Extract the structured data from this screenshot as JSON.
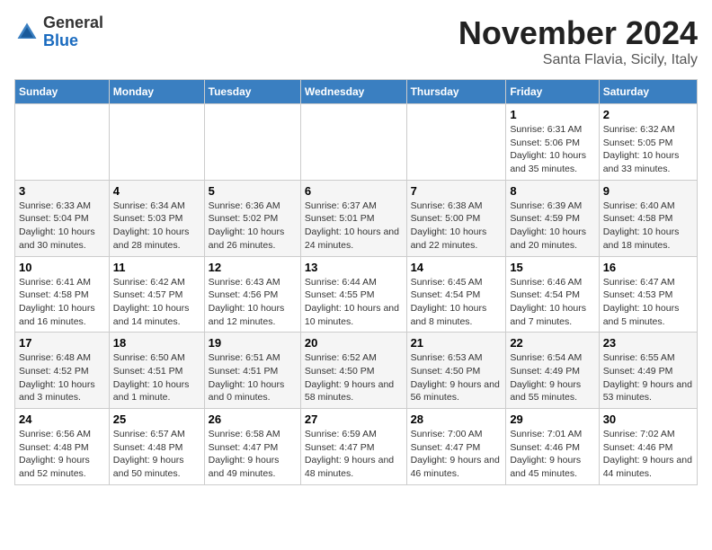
{
  "header": {
    "logo_general": "General",
    "logo_blue": "Blue",
    "month_title": "November 2024",
    "location": "Santa Flavia, Sicily, Italy"
  },
  "days_of_week": [
    "Sunday",
    "Monday",
    "Tuesday",
    "Wednesday",
    "Thursday",
    "Friday",
    "Saturday"
  ],
  "weeks": [
    [
      {
        "day": "",
        "info": ""
      },
      {
        "day": "",
        "info": ""
      },
      {
        "day": "",
        "info": ""
      },
      {
        "day": "",
        "info": ""
      },
      {
        "day": "",
        "info": ""
      },
      {
        "day": "1",
        "info": "Sunrise: 6:31 AM\nSunset: 5:06 PM\nDaylight: 10 hours and 35 minutes."
      },
      {
        "day": "2",
        "info": "Sunrise: 6:32 AM\nSunset: 5:05 PM\nDaylight: 10 hours and 33 minutes."
      }
    ],
    [
      {
        "day": "3",
        "info": "Sunrise: 6:33 AM\nSunset: 5:04 PM\nDaylight: 10 hours and 30 minutes."
      },
      {
        "day": "4",
        "info": "Sunrise: 6:34 AM\nSunset: 5:03 PM\nDaylight: 10 hours and 28 minutes."
      },
      {
        "day": "5",
        "info": "Sunrise: 6:36 AM\nSunset: 5:02 PM\nDaylight: 10 hours and 26 minutes."
      },
      {
        "day": "6",
        "info": "Sunrise: 6:37 AM\nSunset: 5:01 PM\nDaylight: 10 hours and 24 minutes."
      },
      {
        "day": "7",
        "info": "Sunrise: 6:38 AM\nSunset: 5:00 PM\nDaylight: 10 hours and 22 minutes."
      },
      {
        "day": "8",
        "info": "Sunrise: 6:39 AM\nSunset: 4:59 PM\nDaylight: 10 hours and 20 minutes."
      },
      {
        "day": "9",
        "info": "Sunrise: 6:40 AM\nSunset: 4:58 PM\nDaylight: 10 hours and 18 minutes."
      }
    ],
    [
      {
        "day": "10",
        "info": "Sunrise: 6:41 AM\nSunset: 4:58 PM\nDaylight: 10 hours and 16 minutes."
      },
      {
        "day": "11",
        "info": "Sunrise: 6:42 AM\nSunset: 4:57 PM\nDaylight: 10 hours and 14 minutes."
      },
      {
        "day": "12",
        "info": "Sunrise: 6:43 AM\nSunset: 4:56 PM\nDaylight: 10 hours and 12 minutes."
      },
      {
        "day": "13",
        "info": "Sunrise: 6:44 AM\nSunset: 4:55 PM\nDaylight: 10 hours and 10 minutes."
      },
      {
        "day": "14",
        "info": "Sunrise: 6:45 AM\nSunset: 4:54 PM\nDaylight: 10 hours and 8 minutes."
      },
      {
        "day": "15",
        "info": "Sunrise: 6:46 AM\nSunset: 4:54 PM\nDaylight: 10 hours and 7 minutes."
      },
      {
        "day": "16",
        "info": "Sunrise: 6:47 AM\nSunset: 4:53 PM\nDaylight: 10 hours and 5 minutes."
      }
    ],
    [
      {
        "day": "17",
        "info": "Sunrise: 6:48 AM\nSunset: 4:52 PM\nDaylight: 10 hours and 3 minutes."
      },
      {
        "day": "18",
        "info": "Sunrise: 6:50 AM\nSunset: 4:51 PM\nDaylight: 10 hours and 1 minute."
      },
      {
        "day": "19",
        "info": "Sunrise: 6:51 AM\nSunset: 4:51 PM\nDaylight: 10 hours and 0 minutes."
      },
      {
        "day": "20",
        "info": "Sunrise: 6:52 AM\nSunset: 4:50 PM\nDaylight: 9 hours and 58 minutes."
      },
      {
        "day": "21",
        "info": "Sunrise: 6:53 AM\nSunset: 4:50 PM\nDaylight: 9 hours and 56 minutes."
      },
      {
        "day": "22",
        "info": "Sunrise: 6:54 AM\nSunset: 4:49 PM\nDaylight: 9 hours and 55 minutes."
      },
      {
        "day": "23",
        "info": "Sunrise: 6:55 AM\nSunset: 4:49 PM\nDaylight: 9 hours and 53 minutes."
      }
    ],
    [
      {
        "day": "24",
        "info": "Sunrise: 6:56 AM\nSunset: 4:48 PM\nDaylight: 9 hours and 52 minutes."
      },
      {
        "day": "25",
        "info": "Sunrise: 6:57 AM\nSunset: 4:48 PM\nDaylight: 9 hours and 50 minutes."
      },
      {
        "day": "26",
        "info": "Sunrise: 6:58 AM\nSunset: 4:47 PM\nDaylight: 9 hours and 49 minutes."
      },
      {
        "day": "27",
        "info": "Sunrise: 6:59 AM\nSunset: 4:47 PM\nDaylight: 9 hours and 48 minutes."
      },
      {
        "day": "28",
        "info": "Sunrise: 7:00 AM\nSunset: 4:47 PM\nDaylight: 9 hours and 46 minutes."
      },
      {
        "day": "29",
        "info": "Sunrise: 7:01 AM\nSunset: 4:46 PM\nDaylight: 9 hours and 45 minutes."
      },
      {
        "day": "30",
        "info": "Sunrise: 7:02 AM\nSunset: 4:46 PM\nDaylight: 9 hours and 44 minutes."
      }
    ]
  ]
}
